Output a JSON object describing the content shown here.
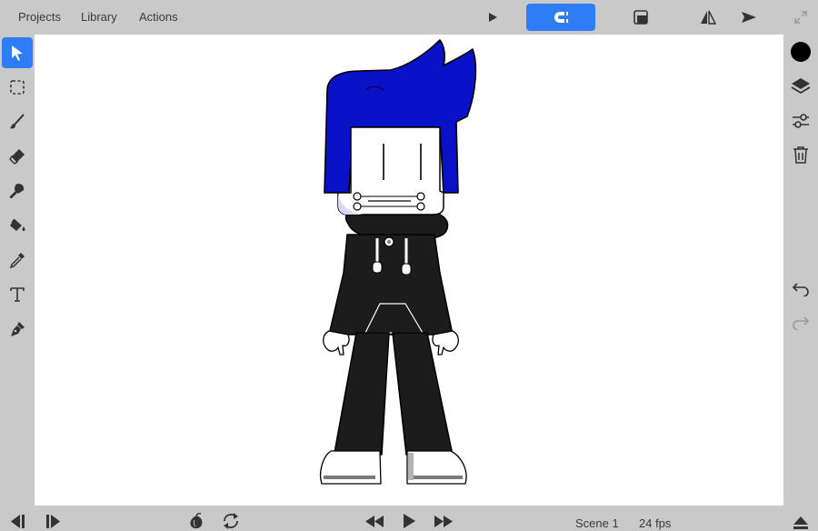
{
  "menu": {
    "projects": "Projects",
    "library": "Library",
    "actions": "Actions"
  },
  "toolbar": {
    "play_icon": "play-small-icon",
    "magnet_icon": "magnet-icon",
    "onion_skin_icon": "layer-mask-icon",
    "flip_icon": "flip-horizontal-icon",
    "send_icon": "send-icon",
    "expand_icon": "expand-icon"
  },
  "tools": [
    {
      "name": "select",
      "icon": "arrow-pointer-icon",
      "active": true
    },
    {
      "name": "marquee",
      "icon": "dashed-selection-icon",
      "active": false
    },
    {
      "name": "brush",
      "icon": "brush-icon",
      "active": false
    },
    {
      "name": "eraser",
      "icon": "eraser-icon",
      "active": false
    },
    {
      "name": "smudge",
      "icon": "smudge-icon",
      "active": false
    },
    {
      "name": "fill",
      "icon": "paint-bucket-icon",
      "active": false
    },
    {
      "name": "eyedropper",
      "icon": "eyedropper-icon",
      "active": false
    },
    {
      "name": "text",
      "icon": "text-icon",
      "active": false
    },
    {
      "name": "pen",
      "icon": "pen-nib-icon",
      "active": false
    }
  ],
  "right_tools": {
    "color": "#000000",
    "layers_icon": "layers-icon",
    "adjust_icon": "sliders-icon",
    "delete_icon": "trash-icon",
    "undo_icon": "undo-icon",
    "redo_icon": "redo-icon"
  },
  "bottom": {
    "scene_label": "Scene 1",
    "fps_label": "24 fps"
  },
  "colors": {
    "accent": "#2f7df6",
    "chrome": "#c9c9c9",
    "canvas": "#ffffff",
    "hair": "#0a12c8",
    "hoodie": "#1c1c1c"
  }
}
